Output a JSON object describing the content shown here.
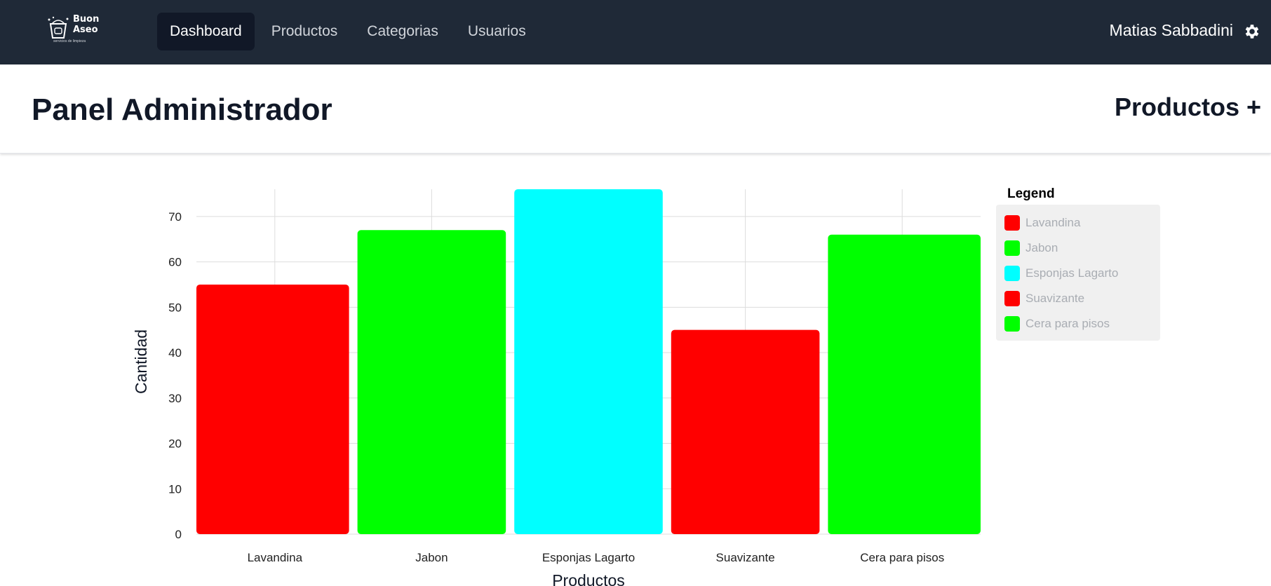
{
  "navbar": {
    "brand_line1": "Buon",
    "brand_line2": "Aseo",
    "brand_tagline": "servicios de limpieza",
    "links": [
      {
        "label": "Dashboard",
        "active": true
      },
      {
        "label": "Productos",
        "active": false
      },
      {
        "label": "Categorias",
        "active": false
      },
      {
        "label": "Usuarios",
        "active": false
      }
    ],
    "user_name": "Matias Sabbadini",
    "settings_icon": "gear-icon"
  },
  "header": {
    "title": "Panel Administrador",
    "products_link": "Productos +"
  },
  "legend": {
    "title": "Legend",
    "items": [
      {
        "label": "Lavandina",
        "color": "#ff0000"
      },
      {
        "label": "Jabon",
        "color": "#00ff00"
      },
      {
        "label": "Esponjas Lagarto",
        "color": "#00ffff"
      },
      {
        "label": "Suavizante",
        "color": "#ff0000"
      },
      {
        "label": "Cera para pisos",
        "color": "#00ff00"
      }
    ]
  },
  "chart_data": {
    "type": "bar",
    "categories": [
      "Lavandina",
      "Jabon",
      "Esponjas Lagarto",
      "Suavizante",
      "Cera para pisos"
    ],
    "values": [
      55,
      67,
      76,
      45,
      66
    ],
    "colors": [
      "#ff0000",
      "#00ff00",
      "#00ffff",
      "#ff0000",
      "#00ff00"
    ],
    "xlabel": "Productos",
    "ylabel": "Cantidad",
    "yticks": [
      0,
      10,
      20,
      30,
      40,
      50,
      60,
      70
    ],
    "ylim": [
      0,
      76
    ],
    "grid": true,
    "legend_position": "right"
  }
}
